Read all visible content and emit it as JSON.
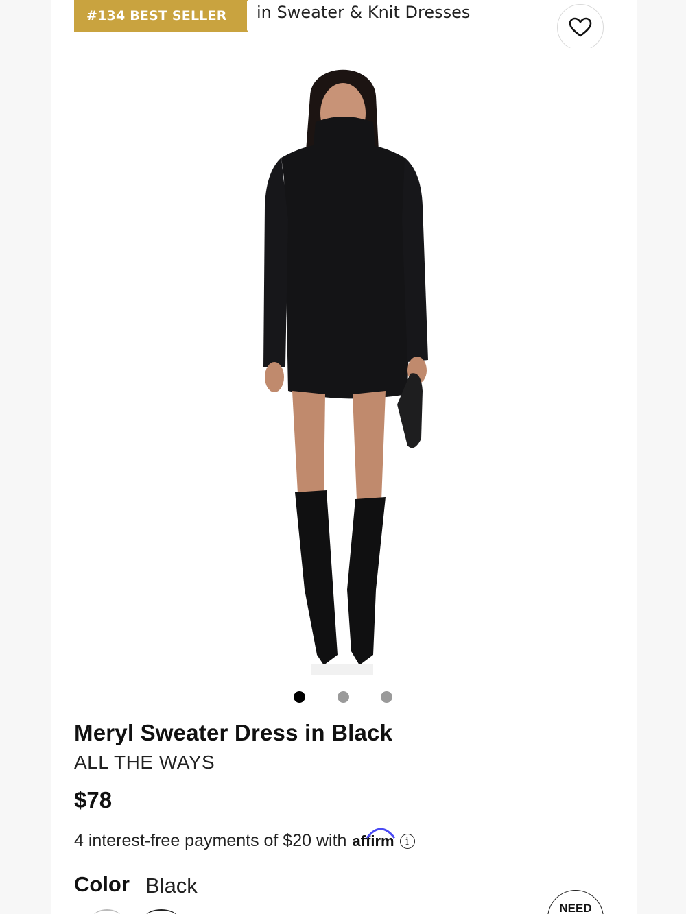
{
  "badge": {
    "rank": "#134 BEST SELLER",
    "category": "in Sweater & Knit Dresses",
    "color": "#c9a33f"
  },
  "wishlist": {
    "icon": "heart-icon"
  },
  "gallery": {
    "image_count": 3,
    "active_index": 0
  },
  "product": {
    "name": "Meryl Sweater Dress in Black",
    "brand": "ALL THE WAYS",
    "price": "$78"
  },
  "payment": {
    "text": "4 interest-free payments of $20 with",
    "provider": "affirm",
    "info_icon": "info-icon",
    "info_symbol": "i"
  },
  "color": {
    "label": "Color",
    "value": "Black"
  },
  "help": {
    "label": "NEED"
  }
}
